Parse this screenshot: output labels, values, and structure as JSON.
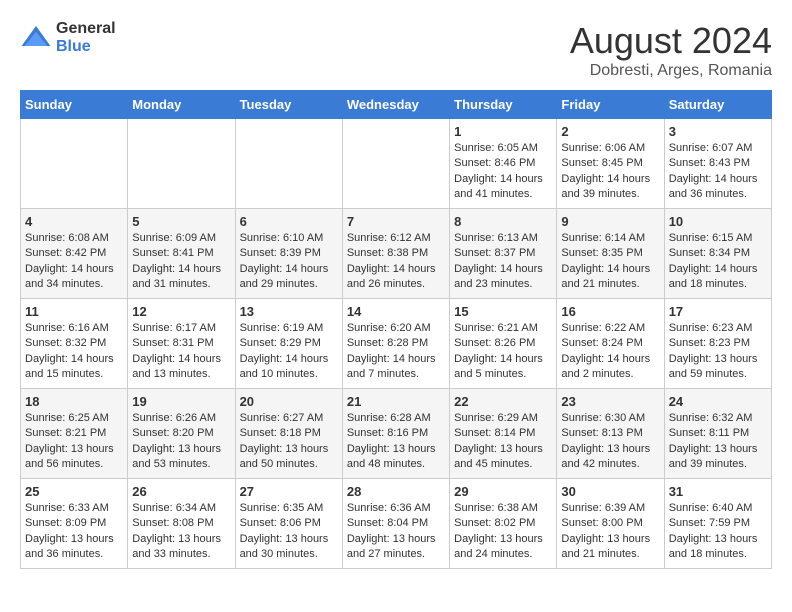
{
  "logo": {
    "general": "General",
    "blue": "Blue"
  },
  "title": "August 2024",
  "subtitle": "Dobresti, Arges, Romania",
  "days_of_week": [
    "Sunday",
    "Monday",
    "Tuesday",
    "Wednesday",
    "Thursday",
    "Friday",
    "Saturday"
  ],
  "weeks": [
    [
      {
        "day": "",
        "info": ""
      },
      {
        "day": "",
        "info": ""
      },
      {
        "day": "",
        "info": ""
      },
      {
        "day": "",
        "info": ""
      },
      {
        "day": "1",
        "info": "Sunrise: 6:05 AM\nSunset: 8:46 PM\nDaylight: 14 hours\nand 41 minutes."
      },
      {
        "day": "2",
        "info": "Sunrise: 6:06 AM\nSunset: 8:45 PM\nDaylight: 14 hours\nand 39 minutes."
      },
      {
        "day": "3",
        "info": "Sunrise: 6:07 AM\nSunset: 8:43 PM\nDaylight: 14 hours\nand 36 minutes."
      }
    ],
    [
      {
        "day": "4",
        "info": "Sunrise: 6:08 AM\nSunset: 8:42 PM\nDaylight: 14 hours\nand 34 minutes."
      },
      {
        "day": "5",
        "info": "Sunrise: 6:09 AM\nSunset: 8:41 PM\nDaylight: 14 hours\nand 31 minutes."
      },
      {
        "day": "6",
        "info": "Sunrise: 6:10 AM\nSunset: 8:39 PM\nDaylight: 14 hours\nand 29 minutes."
      },
      {
        "day": "7",
        "info": "Sunrise: 6:12 AM\nSunset: 8:38 PM\nDaylight: 14 hours\nand 26 minutes."
      },
      {
        "day": "8",
        "info": "Sunrise: 6:13 AM\nSunset: 8:37 PM\nDaylight: 14 hours\nand 23 minutes."
      },
      {
        "day": "9",
        "info": "Sunrise: 6:14 AM\nSunset: 8:35 PM\nDaylight: 14 hours\nand 21 minutes."
      },
      {
        "day": "10",
        "info": "Sunrise: 6:15 AM\nSunset: 8:34 PM\nDaylight: 14 hours\nand 18 minutes."
      }
    ],
    [
      {
        "day": "11",
        "info": "Sunrise: 6:16 AM\nSunset: 8:32 PM\nDaylight: 14 hours\nand 15 minutes."
      },
      {
        "day": "12",
        "info": "Sunrise: 6:17 AM\nSunset: 8:31 PM\nDaylight: 14 hours\nand 13 minutes."
      },
      {
        "day": "13",
        "info": "Sunrise: 6:19 AM\nSunset: 8:29 PM\nDaylight: 14 hours\nand 10 minutes."
      },
      {
        "day": "14",
        "info": "Sunrise: 6:20 AM\nSunset: 8:28 PM\nDaylight: 14 hours\nand 7 minutes."
      },
      {
        "day": "15",
        "info": "Sunrise: 6:21 AM\nSunset: 8:26 PM\nDaylight: 14 hours\nand 5 minutes."
      },
      {
        "day": "16",
        "info": "Sunrise: 6:22 AM\nSunset: 8:24 PM\nDaylight: 14 hours\nand 2 minutes."
      },
      {
        "day": "17",
        "info": "Sunrise: 6:23 AM\nSunset: 8:23 PM\nDaylight: 13 hours\nand 59 minutes."
      }
    ],
    [
      {
        "day": "18",
        "info": "Sunrise: 6:25 AM\nSunset: 8:21 PM\nDaylight: 13 hours\nand 56 minutes."
      },
      {
        "day": "19",
        "info": "Sunrise: 6:26 AM\nSunset: 8:20 PM\nDaylight: 13 hours\nand 53 minutes."
      },
      {
        "day": "20",
        "info": "Sunrise: 6:27 AM\nSunset: 8:18 PM\nDaylight: 13 hours\nand 50 minutes."
      },
      {
        "day": "21",
        "info": "Sunrise: 6:28 AM\nSunset: 8:16 PM\nDaylight: 13 hours\nand 48 minutes."
      },
      {
        "day": "22",
        "info": "Sunrise: 6:29 AM\nSunset: 8:14 PM\nDaylight: 13 hours\nand 45 minutes."
      },
      {
        "day": "23",
        "info": "Sunrise: 6:30 AM\nSunset: 8:13 PM\nDaylight: 13 hours\nand 42 minutes."
      },
      {
        "day": "24",
        "info": "Sunrise: 6:32 AM\nSunset: 8:11 PM\nDaylight: 13 hours\nand 39 minutes."
      }
    ],
    [
      {
        "day": "25",
        "info": "Sunrise: 6:33 AM\nSunset: 8:09 PM\nDaylight: 13 hours\nand 36 minutes."
      },
      {
        "day": "26",
        "info": "Sunrise: 6:34 AM\nSunset: 8:08 PM\nDaylight: 13 hours\nand 33 minutes."
      },
      {
        "day": "27",
        "info": "Sunrise: 6:35 AM\nSunset: 8:06 PM\nDaylight: 13 hours\nand 30 minutes."
      },
      {
        "day": "28",
        "info": "Sunrise: 6:36 AM\nSunset: 8:04 PM\nDaylight: 13 hours\nand 27 minutes."
      },
      {
        "day": "29",
        "info": "Sunrise: 6:38 AM\nSunset: 8:02 PM\nDaylight: 13 hours\nand 24 minutes."
      },
      {
        "day": "30",
        "info": "Sunrise: 6:39 AM\nSunset: 8:00 PM\nDaylight: 13 hours\nand 21 minutes."
      },
      {
        "day": "31",
        "info": "Sunrise: 6:40 AM\nSunset: 7:59 PM\nDaylight: 13 hours\nand 18 minutes."
      }
    ]
  ]
}
